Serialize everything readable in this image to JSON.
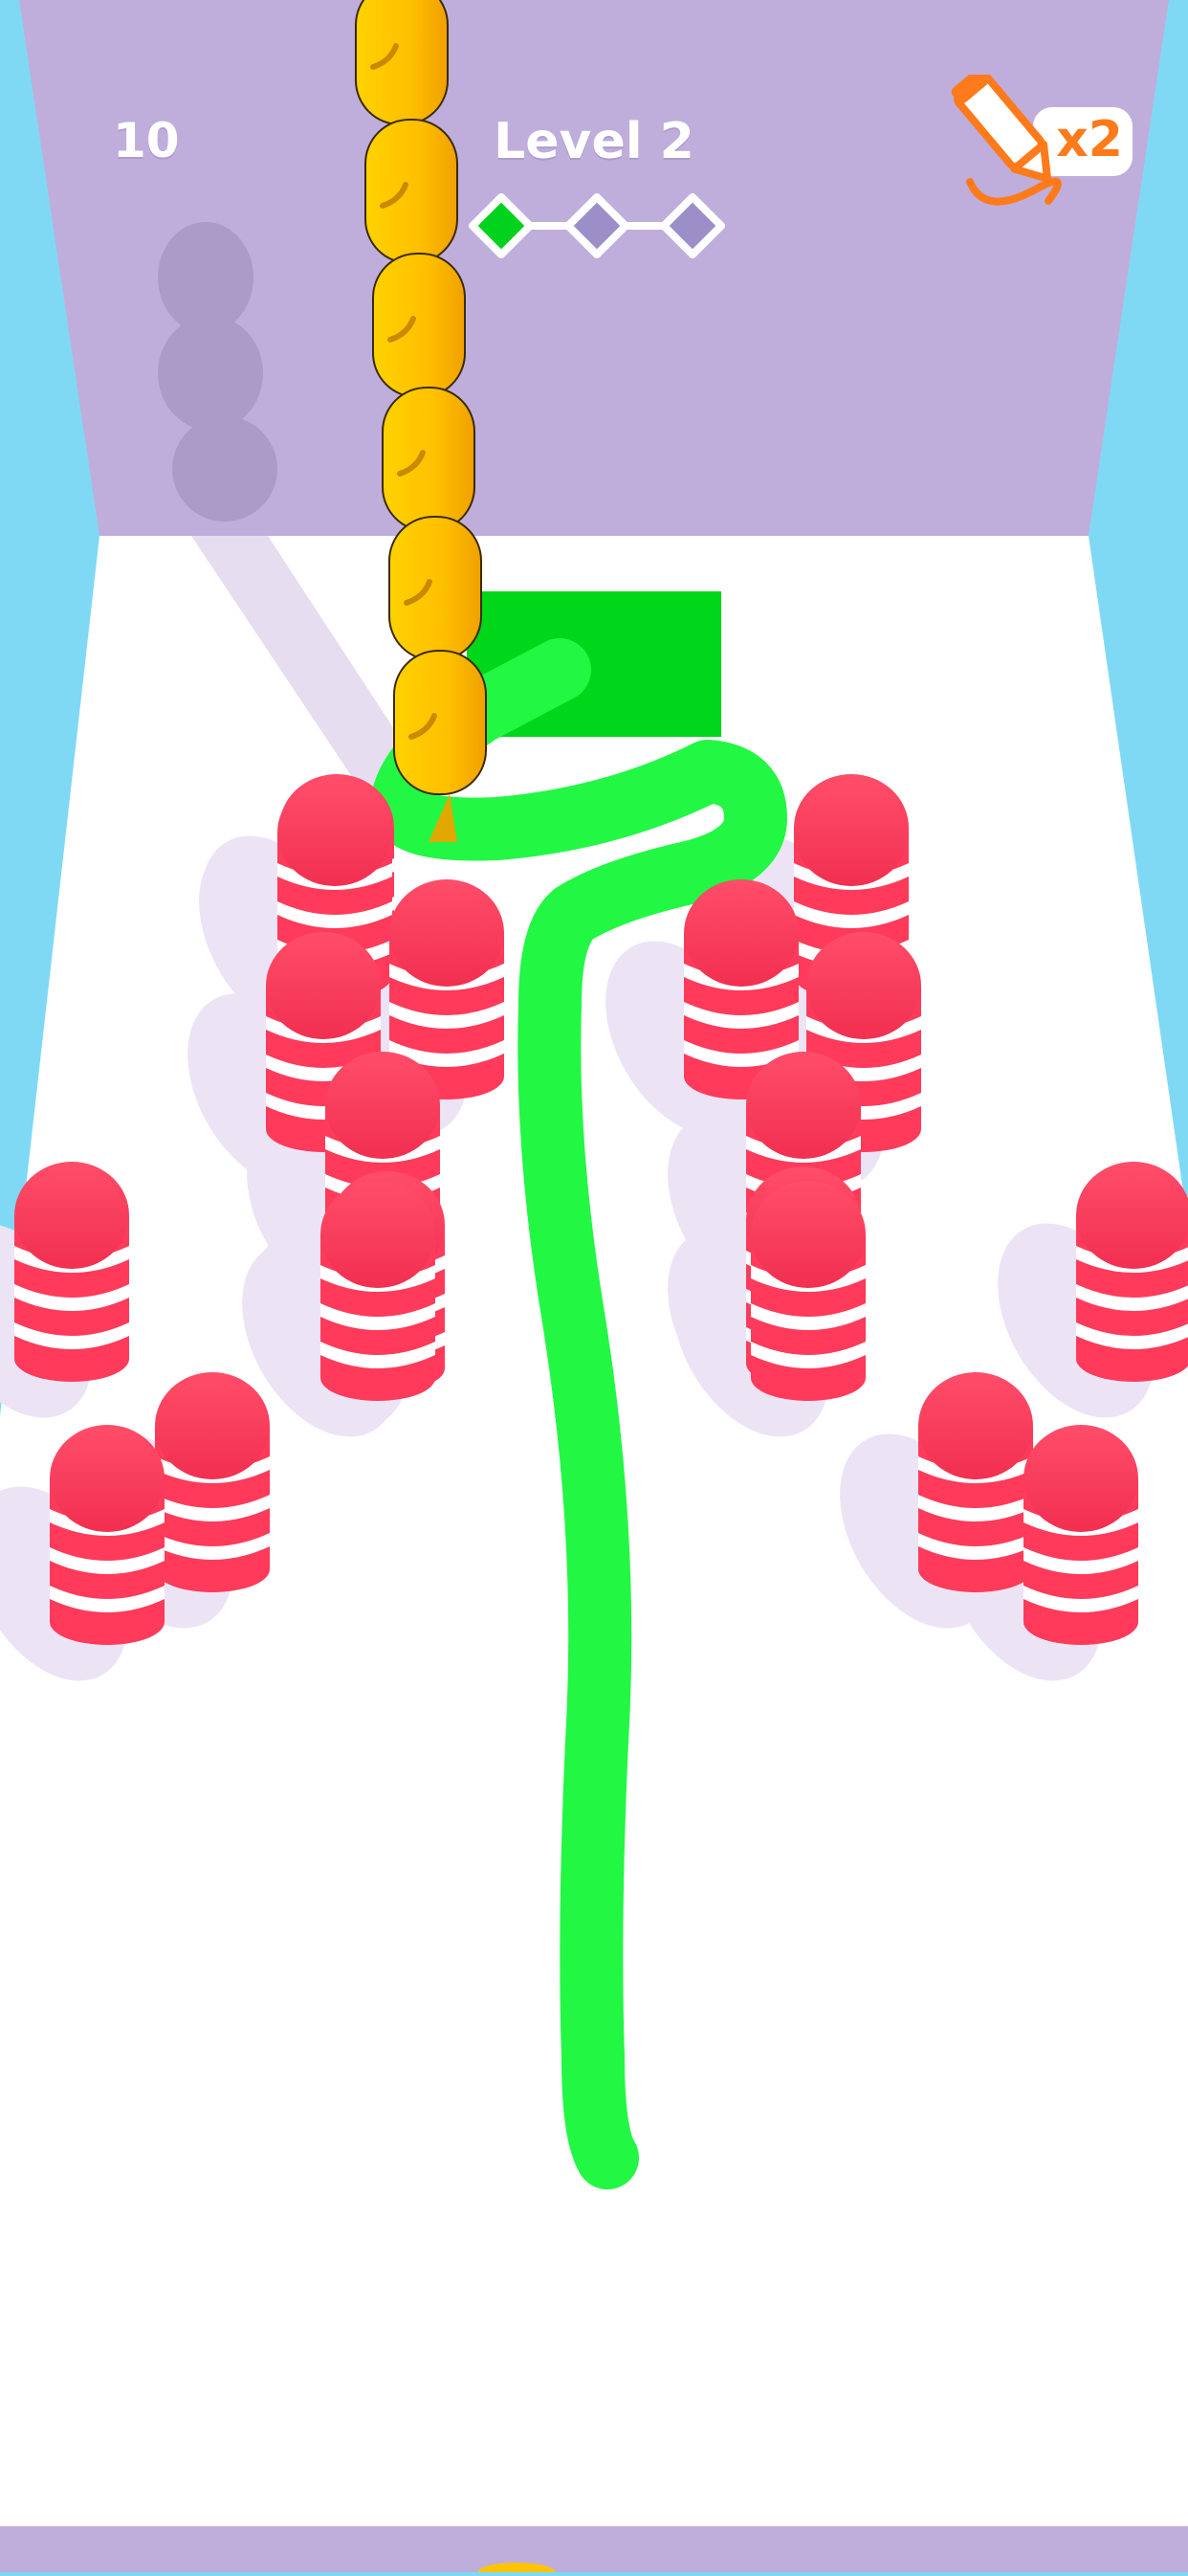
{
  "hud": {
    "score": "10",
    "level_title": "Level 2",
    "pencil_multiplier": "x2"
  },
  "progress": {
    "stages_total": 3,
    "stages_completed": 1,
    "active_color": "#00d21e",
    "inactive_color": "#9c8ec8"
  },
  "colors": {
    "back_wall": "#bfaedb",
    "side_wall": "#7fd9f5",
    "floor": "#ffffff",
    "drawn_path": "#22f744",
    "target_zone": "#00d61a",
    "obstacle_red": "#ff3a5a",
    "crowd_yellow": "#ffc400"
  },
  "crowd": {
    "count": 6
  },
  "obstacles": {
    "count": 20
  },
  "icons": [
    "pencil-icon",
    "diamond-progress-icon"
  ]
}
